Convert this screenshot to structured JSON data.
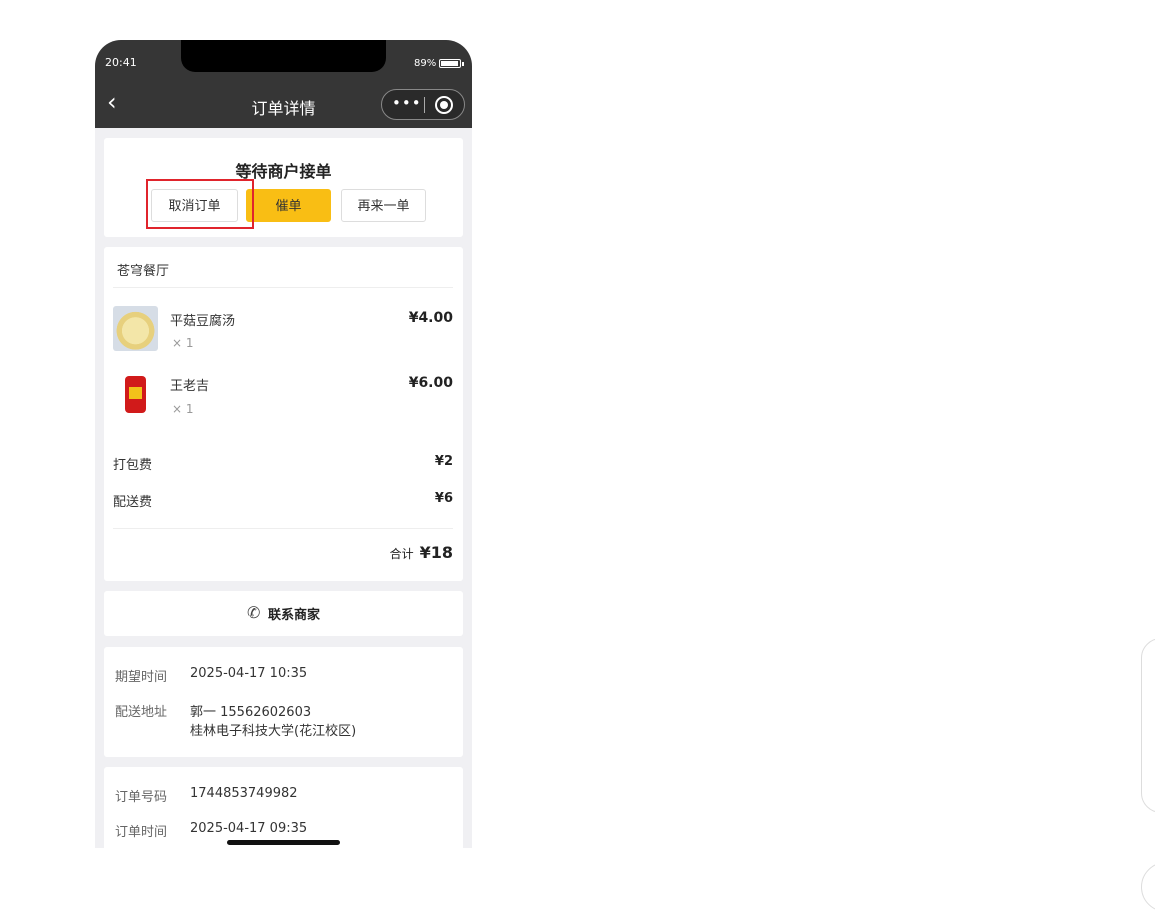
{
  "statusbar": {
    "time": "20:41",
    "battery": "89%"
  },
  "navbar": {
    "back_icon": "‹",
    "title": "订单详情",
    "menu_dots": "•••"
  },
  "order_status": {
    "title": "等待商户接单",
    "buttons": {
      "cancel": "取消订单",
      "urge": "催单",
      "reorder": "再来一单"
    }
  },
  "shop": {
    "name": "苍穹餐厅",
    "items": [
      {
        "name": "平菇豆腐汤",
        "qty": "× 1",
        "price": "¥4.00"
      },
      {
        "name": "王老吉",
        "qty": "× 1",
        "price": "¥6.00"
      }
    ],
    "fees": [
      {
        "label": "打包费",
        "value": "¥2"
      },
      {
        "label": "配送费",
        "value": "¥6"
      }
    ],
    "total_label": "合计",
    "total_value": "¥18"
  },
  "contact": {
    "label": "联系商家"
  },
  "delivery": {
    "expected_label": "期望时间",
    "expected_value": "2025-04-17 10:35",
    "address_label": "配送地址",
    "address_line1": "郭一 15562602603",
    "address_line2": "桂林电子科技大学(花江校区)"
  },
  "order_info": {
    "number_label": "订单号码",
    "number_value": "1744853749982",
    "time_label": "订单时间",
    "time_value": "2025-04-17 09:35"
  },
  "colors": {
    "accent": "#f9be14",
    "header": "#363636",
    "highlight": "#e0242c"
  }
}
